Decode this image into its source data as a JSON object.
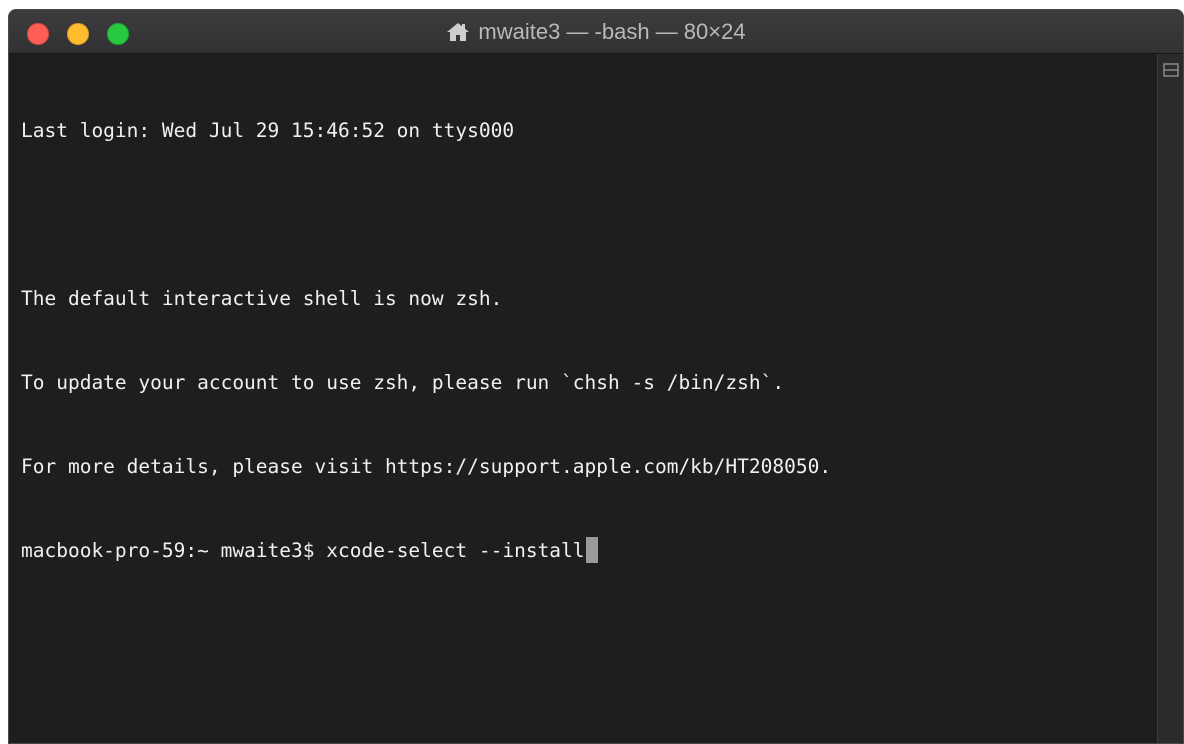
{
  "window": {
    "title": "mwaite3 — -bash — 80×24",
    "title_icon": "home-icon"
  },
  "terminal": {
    "lines": [
      "Last login: Wed Jul 29 15:46:52 on ttys000",
      "",
      "The default interactive shell is now zsh.",
      "To update your account to use zsh, please run `chsh -s /bin/zsh`.",
      "For more details, please visit https://support.apple.com/kb/HT208050."
    ],
    "prompt": "macbook-pro-59:~ mwaite3$ ",
    "command": "xcode-select --install"
  },
  "colors": {
    "background": "#1e1e1e",
    "text": "#f0f0f0",
    "close": "#fd5f57",
    "minimize": "#febc2e",
    "zoom": "#28c840"
  },
  "scrollbar": {
    "icon": "split-pane-icon"
  }
}
